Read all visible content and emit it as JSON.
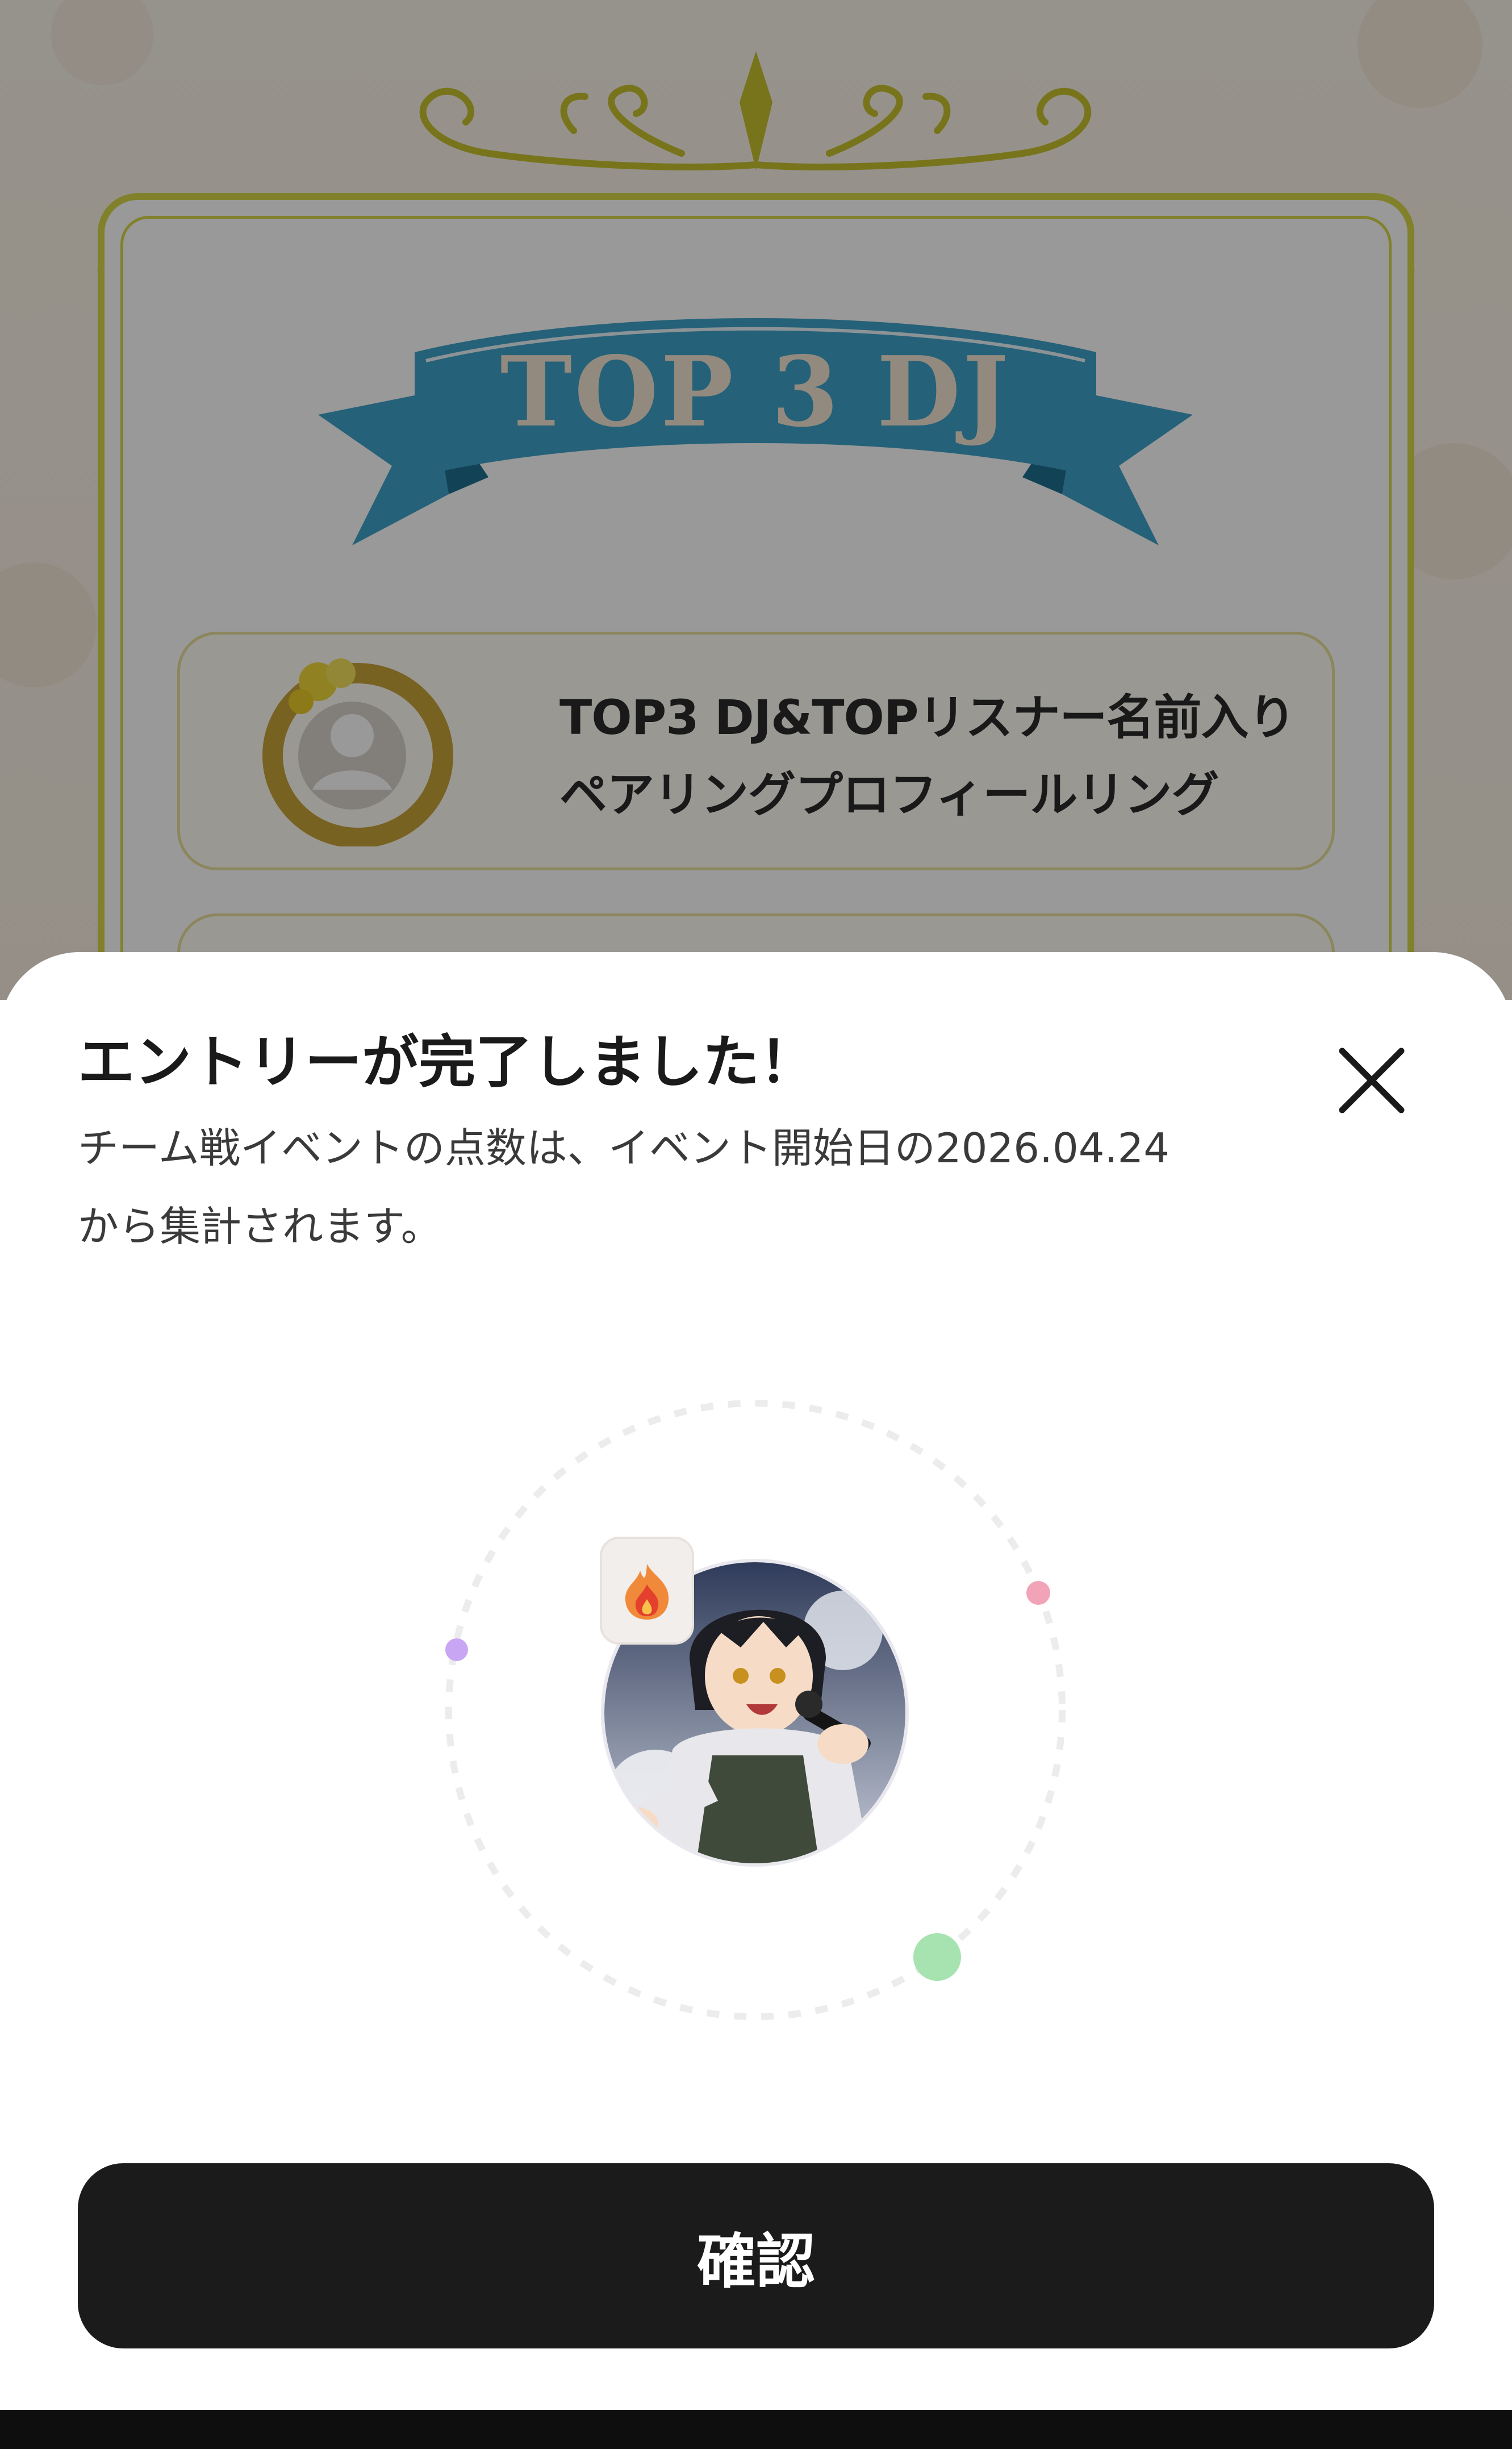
{
  "background": {
    "banner_title": "TOP 3 DJ",
    "prize_1_line1": "TOP3 DJ&TOPリスナー名前入り",
    "prize_1_line2": "ペアリングプロフィールリング",
    "frame_color": "#d8d84a",
    "banner_color": "#3fa2c8"
  },
  "modal": {
    "title": "エントリーが完了しました！",
    "description_line1": "チーム戦イベントの点数は、イベント開始日の2026.04.24",
    "description_line2": "から集計されます。",
    "close_icon": "close-icon",
    "confirm_label": "確認",
    "confirm_color": "#1b1b1b"
  },
  "avatar": {
    "badge_icon": "flame-badge-icon",
    "orbit_dot_colors": [
      "#c9a6f3",
      "#f2a3b8",
      "#a6e3b0"
    ]
  }
}
